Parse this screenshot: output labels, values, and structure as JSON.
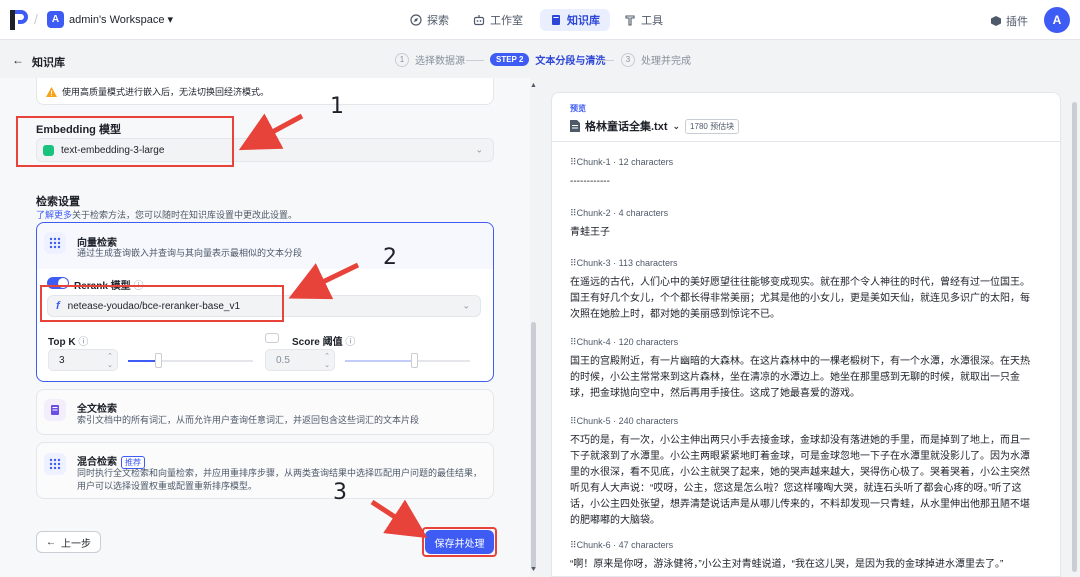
{
  "nav": {
    "workspace_initial": "A",
    "workspace_name": "admin's Workspace",
    "items": [
      {
        "label": "探索",
        "icon": "compass-icon"
      },
      {
        "label": "工作室",
        "icon": "robot-icon"
      },
      {
        "label": "知识库",
        "icon": "book-icon"
      },
      {
        "label": "工具",
        "icon": "wrench-icon"
      }
    ],
    "plugin_label": "插件",
    "user_initial": "A"
  },
  "subbar": {
    "back_title": "知识库",
    "steps": [
      {
        "num": "1",
        "label": "选择数据源"
      },
      {
        "num": "STEP 2",
        "label": "文本分段与清洗"
      },
      {
        "num": "3",
        "label": "处理并完成"
      }
    ]
  },
  "settings": {
    "warning": "使用高质量模式进行嵌入后，无法切换回经济模式。",
    "embedding_label": "Embedding 模型",
    "embedding_value": "text-embedding-3-large",
    "retrieval_title": "检索设置",
    "retrieval_link": "了解更多",
    "retrieval_sub": "关于检索方法，您可以随时在知识库设置中更改此设置。",
    "vector": {
      "title": "向量检索",
      "desc": "通过生成查询嵌入并查询与其向量表示最相似的文本分段"
    },
    "rerank_label": "Rerank 模型",
    "rerank_help": "ⓘ",
    "rerank_value": "netease-youdao/bce-reranker-base_v1",
    "topk_label": "Top K",
    "topk_help": "ⓘ",
    "topk_value": "3",
    "topk_fraction": 0.24,
    "score_label": "Score 阈值",
    "score_help": "ⓘ",
    "score_value": "0.5",
    "score_fraction": 0.55,
    "fulltext": {
      "title": "全文检索",
      "desc": "索引文档中的所有词汇，从而允许用户查询任意词汇，并返回包含这些词汇的文本片段"
    },
    "hybrid": {
      "title": "混合检索",
      "badge": "推荐",
      "desc1": "同时执行全文检索和向量检索，并应用重排序步骤，从两类查询结果中选择匹配用户问题的最佳结果，",
      "desc2": "用户可以选择设置权重或配置重新排序模型。"
    },
    "prev_label": "上一步",
    "save_label": "保存并处理"
  },
  "annotations": [
    "1",
    "2",
    "3"
  ],
  "preview": {
    "label": "预览",
    "file_name": "格林童话全集.txt",
    "chunk_count": "1780 预估块",
    "chunks": [
      {
        "head": "Chunk-1 · 12 characters",
        "lines": [
          "------------"
        ]
      },
      {
        "head": "Chunk-2 · 4 characters",
        "lines": [
          "青蛙王子"
        ]
      },
      {
        "head": "Chunk-3 · 113 characters",
        "lines": [
          "在遥远的古代，人们心中的美好愿望往往能够变成现实。就在那个令人神往的时代，曾经有过一位国王。",
          "国王有好几个女儿，个个都长得非常美丽；尤其是他的小女儿，更是美如天仙，就连见多识广的太阳，每",
          "次照在她脸上时，都对她的美丽感到惊诧不已。"
        ]
      },
      {
        "head": "Chunk-4 · 120 characters",
        "lines": [
          "国王的宫殿附近，有一片幽暗的大森林。在这片森林中的一棵老椴树下，有一个水潭，水潭很深。在天热",
          "的时候，小公主常常来到这片森林，坐在清凉的水潭边上。她坐在那里感到无聊的时候，就取出一只金",
          "球，把金球抛向空中，然后再用手接住。这成了她最喜爱的游戏。"
        ]
      },
      {
        "head": "Chunk-5 · 240 characters",
        "lines": [
          "不巧的是，有一次，小公主伸出两只小手去接金球，金球却没有落进她的手里，而是掉到了地上，而且一",
          "下子就滚到了水潭里。小公主两眼紧紧地盯着金球，可是金球忽地一下子在水潭里就没影儿了。因为水潭",
          "里的水很深，看不见底，小公主就哭了起来，她的哭声越来越大，哭得伤心极了。哭着哭着，小公主突然",
          "听见有人大声说：“哎呀，公主，您这是怎么啦？您这样嚎啕大哭，就连石头听了都会心疼的呀。”听了这",
          "话，小公主四处张望，想弄清楚说话声是从哪儿传来的，不料却发现一只青蛙，从水里伸出他那丑陋不堪",
          "的肥嘟嘟的大脑袋。"
        ]
      },
      {
        "head": "Chunk-6 · 47 characters",
        "lines": [
          "“啊！原来是你呀，游泳健将，”小公主对青蛙说道，“我在这儿哭，是因为我的金球掉进水潭里去了。”"
        ]
      }
    ]
  },
  "colors": {
    "accent": "#3e5cf3",
    "highlight": "#e8433a"
  }
}
